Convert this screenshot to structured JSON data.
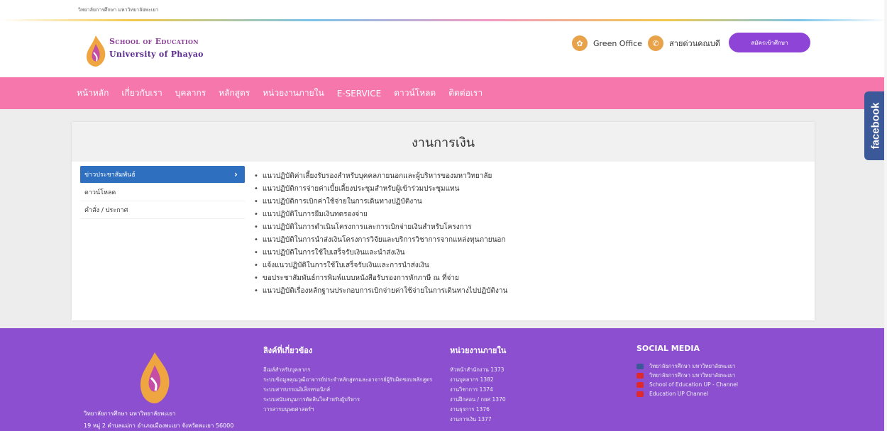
{
  "topbar": {
    "org": "วิทยาลัยการศึกษา มหาวิทยาลัยพะเยา"
  },
  "brand": {
    "line1": "School of Education",
    "line2": "University of Phayao"
  },
  "header_links": {
    "green_office": "Green Office",
    "hotline": "สายด่วนคณบดี",
    "apply": "สมัครเข้าศึกษา"
  },
  "nav": [
    "หน้าหลัก",
    "เกี่ยวกับเรา",
    "บุคลากร",
    "หลักสูตร",
    "หน่วยงานภายใน",
    "E-SERVICE",
    "ดาวน์โหลด",
    "ติดต่อเรา"
  ],
  "facebook_tab": "facebook",
  "page": {
    "title": "งานการเงิน",
    "sidebar": [
      {
        "label": "ข่าวประชาสัมพันธ์",
        "active": true
      },
      {
        "label": "ดาวน์โหลด",
        "active": false
      },
      {
        "label": "คำสั่ง / ประกาศ",
        "active": false
      }
    ],
    "links": [
      "แนวปฏิบัติค่าเลี้ยงรับรองสำหรับบุคคลภายนอกและผู้บริหารของมหาวิทยาลัย",
      "แนวปฏิบัติการจ่ายค่าเบี้ยเลี้ยงประชุมสำหรับผู้เข้าร่วมประชุมแทน",
      "แนวปฏิบัติการเบิกค่าใช้จ่ายในการเดินทางปฏิบัติงาน",
      "แนวปฏิบัติในการยืมเงินทดรองจ่าย",
      "แนวปฏิบัติในการดำเนินโครงการและการเบิกจ่ายเงินสำหรับโครงการ",
      "แนวปฏิบัติในการนำส่งเงินโครงการวิจัยและบริการวิชาการจากแหล่งทุนภายนอก",
      "แนวปฏิบัติในการใช้ใบเสร็จรับเงินและนำส่งเงิน",
      "แจ้งแนวปฏิบัติในการใช้ใบเสร็จรับเงินและการนำส่งเงิน",
      "ขอประชาสัมพันธ์การพิมพ์แบบหนังสือรับรองการหักภาษี ณ ที่จ่าย",
      "แนวปฏิบัติเรื่องหลักฐานประกอบการเบิกจ่ายค่าใช้จ่ายในการเดินทางไปปฏิบัติงาน"
    ]
  },
  "footer": {
    "address1": "วิทยาลัยการศึกษา มหาวิทยาลัยพะเยา",
    "address2": "19 หมู่ 2 ตำบลแม่กา อำเภอเมืองพะเยา จังหวัดพะเยา 56000",
    "related": {
      "title": "ลิงค์ที่เกี่ยวข้อง",
      "items": [
        "อีเมล์สำหรับบุคลากร",
        "ระบบข้อมูลคุณวุฒิอาจารย์ประจำหลักสูตรและอาจารย์ผู้รับผิดชอบหลักสูตร",
        "ระบบสารบรรณอิเล็กทรอนิกส์",
        "ระบบสนับสนุนการตัดสินใจสำหรับผู้บริหาร",
        "วารสารมนุษยศาสตร์ฯ"
      ]
    },
    "internal": {
      "title": "หน่วยงานภายใน",
      "items": [
        "หัวหน้าสำนักงาน 1373",
        "งานบุคลากร 1382",
        "งานวิชาการ 1374",
        "งานฝึกสอน / กยศ 1370",
        "งานธุรการ 1376",
        "งานการเงิน 1377"
      ]
    },
    "social": {
      "title": "SOCIAL MEDIA",
      "items": [
        {
          "type": "facebook",
          "label": "วิทยาลัยการศึกษา มหาวิทยาลัยพะเยา"
        },
        {
          "type": "youtube",
          "label": "วิทยาลัยการศึกษา มหาวิทยาลัยพะเยา"
        },
        {
          "type": "youtube",
          "label": "School of Education UP - Channel"
        },
        {
          "type": "youtube",
          "label": "Education UP Channel"
        }
      ]
    }
  },
  "colors": {
    "nav": "#f577ac",
    "footer": "#8b4fd0",
    "active": "#2e6fbf",
    "apply": "#8e44d6"
  }
}
